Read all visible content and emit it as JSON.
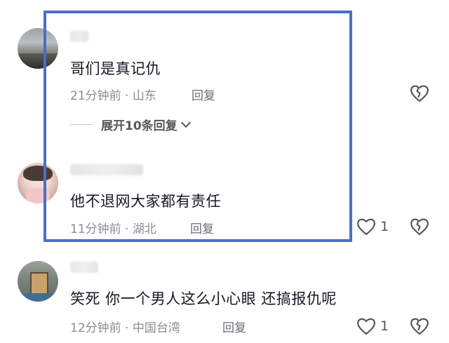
{
  "comments": [
    {
      "text": "哥们是真记仇",
      "time": "21分钟前",
      "location": "山东",
      "reply_label": "回复",
      "expand_label": "展开10条回复",
      "icon_like": "heart-icon",
      "icon_dislike": "broken-heart-icon"
    },
    {
      "text": "他不退网大家都有责任",
      "time": "11分钟前",
      "location": "湖北",
      "reply_label": "回复",
      "like_count": "1"
    },
    {
      "text": "笑死 你一个男人这么小心眼 还搞报仇呢",
      "time": "12分钟前",
      "location": "中国台湾",
      "reply_label": "回复",
      "like_count": "1"
    }
  ],
  "colors": {
    "highlight_border": "#4a6fc4",
    "text": "#161823",
    "meta": "#8a8b91"
  }
}
